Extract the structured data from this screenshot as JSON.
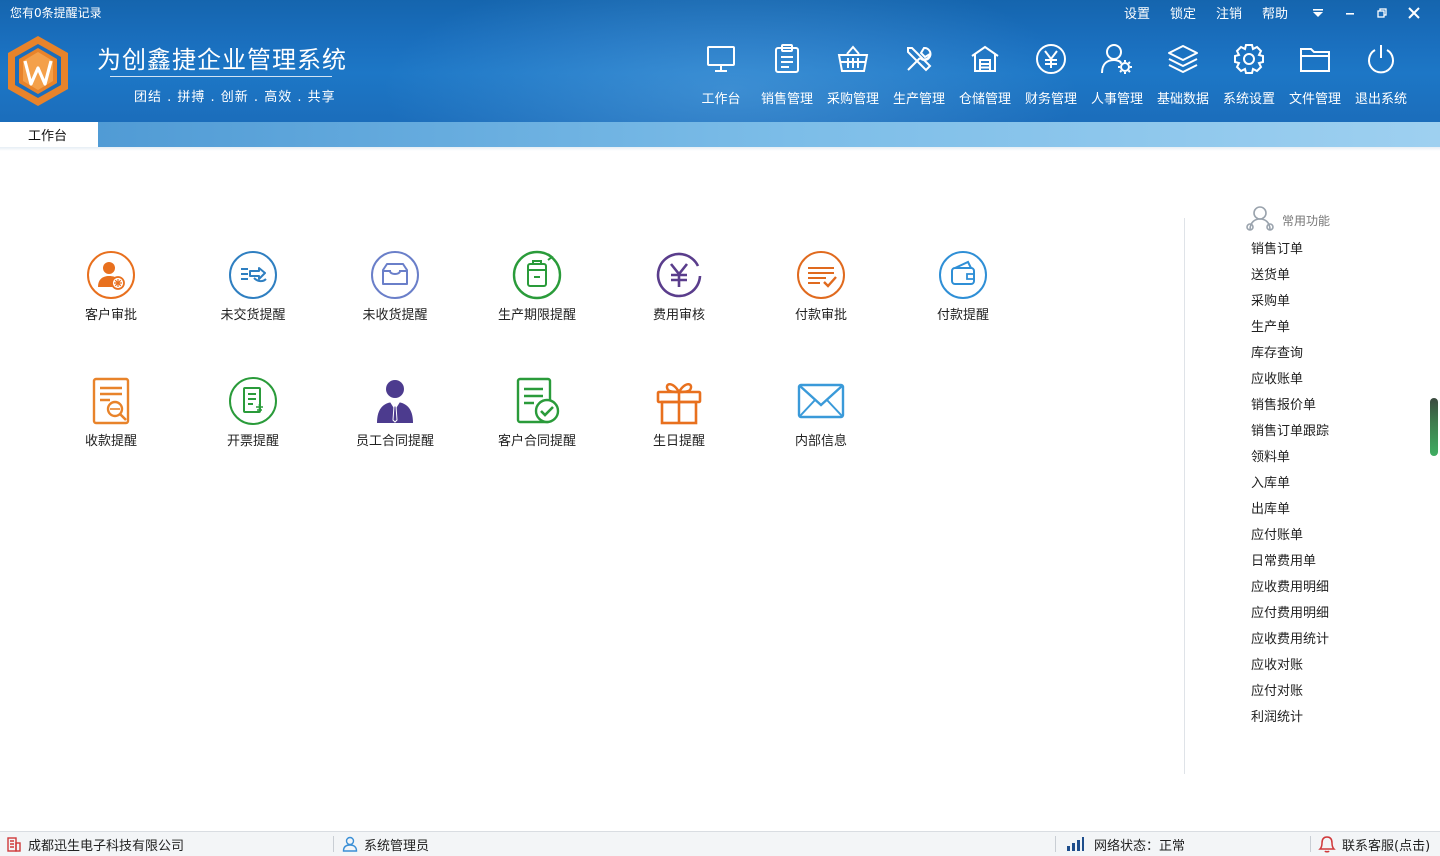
{
  "header": {
    "reminder": "您有0条提醒记录",
    "top_links": [
      "设置",
      "锁定",
      "注销",
      "帮助"
    ],
    "title": "为创鑫捷企业管理系统",
    "subtitle": "团结 . 拼搏 . 创新 . 高效 . 共享",
    "logo_letter": "W",
    "modules": [
      {
        "label": "工作台",
        "icon": "monitor-icon"
      },
      {
        "label": "销售管理",
        "icon": "clipboard-icon"
      },
      {
        "label": "采购管理",
        "icon": "basket-icon"
      },
      {
        "label": "生产管理",
        "icon": "tools-icon"
      },
      {
        "label": "仓储管理",
        "icon": "warehouse-icon"
      },
      {
        "label": "财务管理",
        "icon": "yen-icon"
      },
      {
        "label": "人事管理",
        "icon": "user-gear-icon"
      },
      {
        "label": "基础数据",
        "icon": "layers-icon"
      },
      {
        "label": "系统设置",
        "icon": "gear-icon"
      },
      {
        "label": "文件管理",
        "icon": "folder-icon"
      },
      {
        "label": "退出系统",
        "icon": "power-icon"
      }
    ]
  },
  "tabs": [
    {
      "label": "工作台",
      "active": true
    }
  ],
  "workspace": {
    "items": [
      {
        "label": "客户审批",
        "icon": "customer-approval-icon",
        "color": "#e8701e"
      },
      {
        "label": "未交货提醒",
        "icon": "undelivered-icon",
        "color": "#2f7fc1"
      },
      {
        "label": "未收货提醒",
        "icon": "unreceived-icon",
        "color": "#6a7fc9"
      },
      {
        "label": "生产期限提醒",
        "icon": "production-deadline-icon",
        "color": "#2a9b3a"
      },
      {
        "label": "费用审核",
        "icon": "expense-audit-icon",
        "color": "#5a3d8c"
      },
      {
        "label": "付款审批",
        "icon": "payment-approval-icon",
        "color": "#e06a1e"
      },
      {
        "label": "付款提醒",
        "icon": "wallet-icon",
        "color": "#2f8fd6"
      },
      {
        "label": "收款提醒",
        "icon": "receipt-search-icon",
        "color": "#e8832a"
      },
      {
        "label": "开票提醒",
        "icon": "invoice-icon",
        "color": "#2a9b3a"
      },
      {
        "label": "员工合同提醒",
        "icon": "employee-icon",
        "color": "#4c3b8e"
      },
      {
        "label": "客户合同提醒",
        "icon": "contract-check-icon",
        "color": "#2a9b3a"
      },
      {
        "label": "生日提醒",
        "icon": "gift-icon",
        "color": "#e8701e"
      },
      {
        "label": "内部信息",
        "icon": "mail-icon",
        "color": "#3a9ad9"
      }
    ]
  },
  "quick_functions": {
    "title": "常用功能",
    "items": [
      "销售订单",
      "送货单",
      "采购单",
      "生产单",
      "库存查询",
      "应收账单",
      "销售报价单",
      "销售订单跟踪",
      "领料单",
      "入库单",
      "出库单",
      "应付账单",
      "日常费用单",
      "应收费用明细",
      "应付费用明细",
      "应收费用统计",
      "应收对账",
      "应付对账",
      "利润统计"
    ]
  },
  "statusbar": {
    "company": "成都迅生电子科技有限公司",
    "user": "系统管理员",
    "network": "网络状态：正常",
    "support": "联系客服(点击)"
  },
  "colors": {
    "header_bg": "#1a6fbe",
    "logo_orange": "#e8832a",
    "tab_strip": "#7cbde8"
  }
}
